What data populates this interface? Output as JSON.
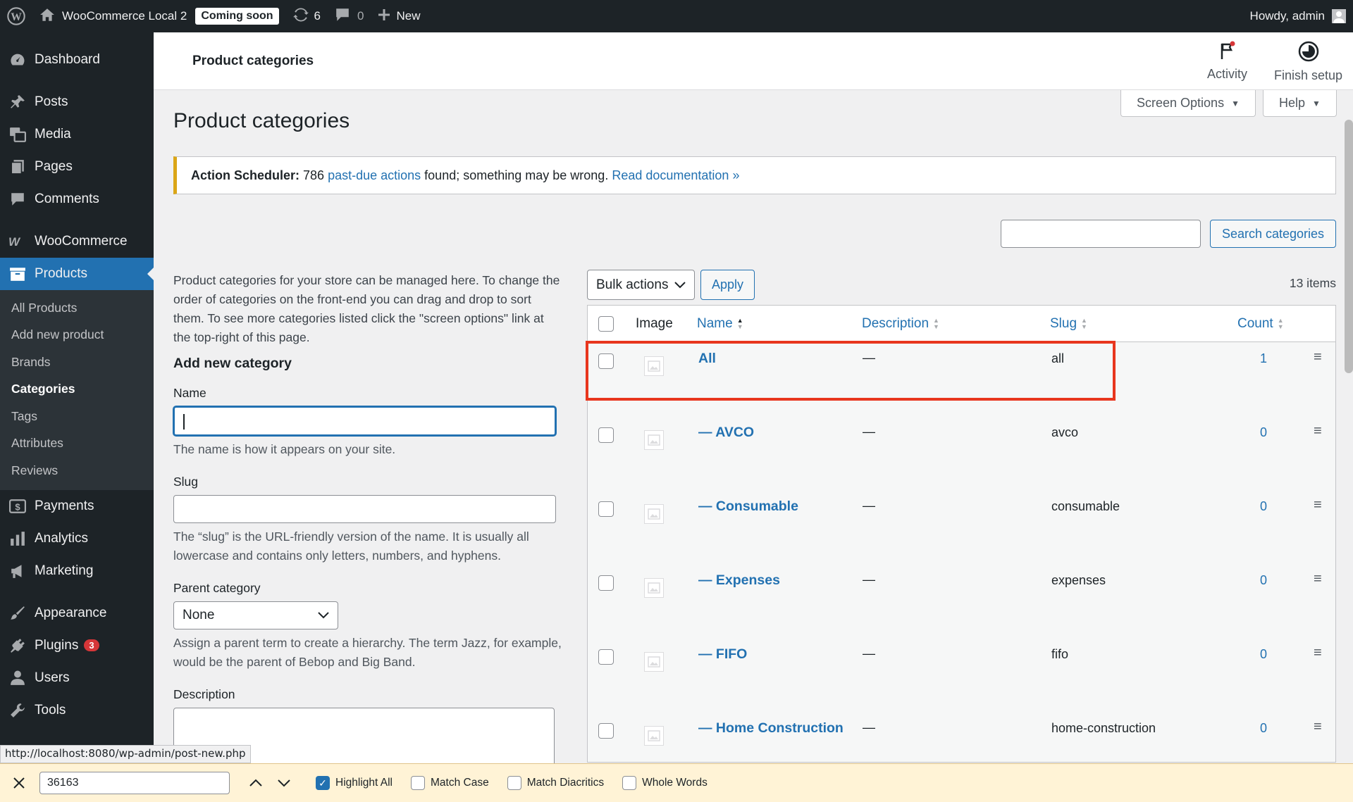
{
  "adminbar": {
    "site_name": "WooCommerce Local 2",
    "coming_soon": "Coming soon",
    "updates_count": "6",
    "comments_count": "0",
    "new_label": "New",
    "howdy": "Howdy, admin"
  },
  "sidebar": {
    "items": [
      {
        "label": "Dashboard",
        "icon": "dashboard-icon"
      },
      {
        "label": "Posts",
        "icon": "pin-icon"
      },
      {
        "label": "Media",
        "icon": "media-icon"
      },
      {
        "label": "Pages",
        "icon": "pages-icon"
      },
      {
        "label": "Comments",
        "icon": "comments-icon"
      },
      {
        "label": "WooCommerce",
        "icon": "woocommerce-icon"
      },
      {
        "label": "Products",
        "icon": "products-icon"
      },
      {
        "label": "Payments",
        "icon": "payments-icon"
      },
      {
        "label": "Analytics",
        "icon": "analytics-icon"
      },
      {
        "label": "Marketing",
        "icon": "megaphone-icon"
      },
      {
        "label": "Appearance",
        "icon": "brush-icon"
      },
      {
        "label": "Plugins",
        "icon": "plugin-icon",
        "badge": "3"
      },
      {
        "label": "Users",
        "icon": "users-icon"
      },
      {
        "label": "Tools",
        "icon": "wrench-icon"
      }
    ],
    "submenu": [
      "All Products",
      "Add new product",
      "Brands",
      "Categories",
      "Tags",
      "Attributes",
      "Reviews"
    ]
  },
  "header": {
    "title": "Product categories",
    "activity": "Activity",
    "finish_setup": "Finish setup"
  },
  "screen_options": "Screen Options",
  "help": "Help",
  "page_title": "Product categories",
  "notice": {
    "prefix": "Action Scheduler:",
    "count": "786",
    "link1": "past-due actions",
    "middle": "found; something may be wrong.",
    "link2": "Read documentation »"
  },
  "search": {
    "value": "",
    "button": "Search categories"
  },
  "form": {
    "intro": "Product categories for your store can be managed here. To change the order of categories on the front-end you can drag and drop to sort them. To see more categories listed click the \"screen options\" link at the top-right of this page.",
    "heading": "Add new category",
    "name_label": "Name",
    "name_help": "The name is how it appears on your site.",
    "slug_label": "Slug",
    "slug_help": "The “slug” is the URL-friendly version of the name. It is usually all lowercase and contains only letters, numbers, and hyphens.",
    "parent_label": "Parent category",
    "parent_value": "None",
    "parent_help": "Assign a parent term to create a hierarchy. The term Jazz, for example, would be the parent of Bebop and Big Band.",
    "description_label": "Description"
  },
  "table": {
    "bulk_actions": "Bulk actions",
    "apply": "Apply",
    "items_count": "13 items",
    "columns": {
      "image": "Image",
      "name": "Name",
      "description": "Description",
      "slug": "Slug",
      "count": "Count"
    },
    "rows": [
      {
        "name": "All",
        "description": "—",
        "slug": "all",
        "count": "1"
      },
      {
        "name": "— AVCO",
        "description": "—",
        "slug": "avco",
        "count": "0"
      },
      {
        "name": "— Consumable",
        "description": "—",
        "slug": "consumable",
        "count": "0"
      },
      {
        "name": "— Expenses",
        "description": "—",
        "slug": "expenses",
        "count": "0"
      },
      {
        "name": "— FIFO",
        "description": "—",
        "slug": "fifo",
        "count": "0"
      },
      {
        "name": "— Home Construction",
        "description": "—",
        "slug": "home-construction",
        "count": "0"
      }
    ]
  },
  "status_url": "http://localhost:8080/wp-admin/post-new.php",
  "findbar": {
    "query": "36163",
    "highlight_all": "Highlight All",
    "match_case": "Match Case",
    "match_diacritics": "Match Diacritics",
    "whole_words": "Whole Words"
  }
}
